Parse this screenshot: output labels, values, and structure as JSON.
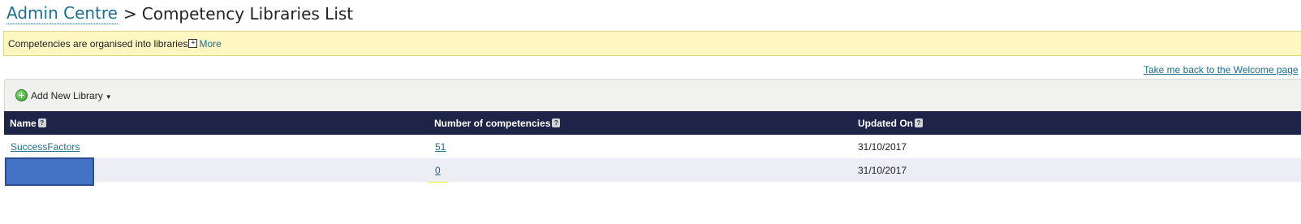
{
  "breadcrumb": {
    "parent_label": "Admin Centre",
    "separator": ">",
    "current_label": "Competency Libraries List"
  },
  "info_bar": {
    "text": "Competencies are organised into libraries",
    "expand_symbol": "+",
    "more_label": "More"
  },
  "welcome_link": "Take me back to the Welcome page",
  "toolbar": {
    "add_library_label": "Add New Library",
    "dropdown_caret": "▼"
  },
  "table": {
    "columns": [
      {
        "label": "Name"
      },
      {
        "label": "Number of competencies"
      },
      {
        "label": "Updated On"
      }
    ],
    "help_symbol": "?",
    "rows": [
      {
        "name": "SuccessFactors",
        "count": "51",
        "updated": "31/10/2017"
      },
      {
        "name": "",
        "count": "0",
        "updated": "31/10/2017",
        "name_redacted": true
      }
    ]
  },
  "colors": {
    "header_bg": "#1d2447",
    "link": "#1f6e8c",
    "info_bg": "#fff7c2",
    "highlight": "#f7f41a",
    "redaction": "#4472c4"
  }
}
